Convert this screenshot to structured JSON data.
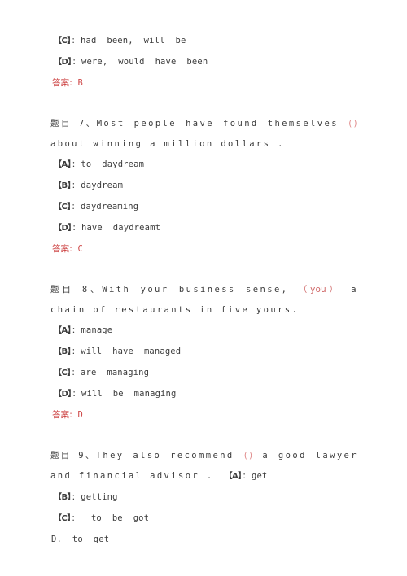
{
  "document": {
    "type": "exam-answer-sheet",
    "language": "zh-CN / en",
    "text_color": "#3c3c3c",
    "answer_color": "#cf4a4a",
    "blank_marker_color": "#e08a8a",
    "background_color": "#ffffff"
  },
  "labels": {
    "question_prefix": "题目",
    "answer_prefix": "答案",
    "full_colon": "：",
    "ideographic_comma": "、",
    "bracket_open": "【",
    "bracket_close": "】"
  },
  "carryover": {
    "options": [
      {
        "key": "C",
        "marker": "【C】",
        "colon": "：",
        "text": "had  been,  will  be"
      },
      {
        "key": "D",
        "marker": "【D】",
        "colon": "：",
        "text": "were,  would  have  been"
      }
    ],
    "answer_label": "答案:",
    "answer_value": "B"
  },
  "questions": [
    {
      "number": "7",
      "prefix": "题目",
      "number_suffix": "、",
      "stem_before_blank": "Most  people  have  found  themselves ",
      "blank": "()",
      "stem_after_blank": "   about  winning  a million  dollars .",
      "stem_line1": "题目 7、Most  people  have  found  themselves ()   about",
      "stem_line2": "winning  a million  dollars .",
      "options": [
        {
          "key": "A",
          "marker": "【A】",
          "colon": "：",
          "text": "to  daydream"
        },
        {
          "key": "B",
          "marker": "【B】",
          "colon": "：",
          "text": "daydream"
        },
        {
          "key": "C",
          "marker": "【C】",
          "colon": "：",
          "text": "daydreaming"
        },
        {
          "key": "D",
          "marker": "【D】",
          "colon": "：",
          "text": "have  daydreamt"
        }
      ],
      "answer_label": "答案:",
      "answer_value": "C"
    },
    {
      "number": "8",
      "prefix": "题目",
      "number_suffix": "、",
      "stem_before_blank": "With  your  business  sense, ",
      "blank": "（you）",
      "stem_after_blank": "  a  chain  of  restaurants  in  five yours.",
      "stem_line1": "题目 8、With  your  business  sense,  （you）  a  chain  of",
      "stem_line2": "restaurants  in  five yours.",
      "options": [
        {
          "key": "A",
          "marker": "【A】",
          "colon": "：",
          "text": "manage"
        },
        {
          "key": "B",
          "marker": "【B】",
          "colon": "：",
          "text": "will  have  managed"
        },
        {
          "key": "C",
          "marker": "【C】",
          "colon": "：",
          "text": "are  managing"
        },
        {
          "key": "D",
          "marker": "【D】",
          "colon": "：",
          "text": "will  be  managing"
        }
      ],
      "answer_label": "答案:",
      "answer_value": "D"
    },
    {
      "number": "9",
      "prefix": "题目",
      "number_suffix": "、",
      "stem_before_blank": "They  also  recommend ",
      "blank": "()",
      "stem_after_blank": "  a  good  lawyer  and  financial  advisor .",
      "stem_line1": "题目 9、They  also  recommend ()  a  good  lawyer  and  financial",
      "stem_line2": "advisor .   【A】：get",
      "inline_option": {
        "key": "A",
        "marker": "【A】",
        "colon": "：",
        "text": "get"
      },
      "options": [
        {
          "key": "B",
          "marker": "【B】",
          "colon": "：",
          "text": "getting"
        },
        {
          "key": "C",
          "marker": "【C】",
          "colon": "：",
          "text": "  to  be  got"
        },
        {
          "key": "D",
          "marker": "D.",
          "colon": "",
          "text": "  to  get"
        }
      ],
      "answer_label": "",
      "answer_value": ""
    }
  ]
}
